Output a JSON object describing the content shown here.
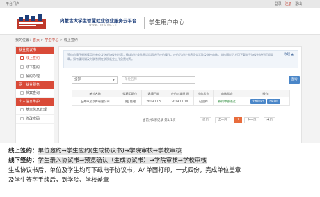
{
  "topbar": {
    "home_label": "平台门户",
    "login_link": "登录",
    "register_link": "注册",
    "extra": "退出"
  },
  "header": {
    "site_title": "内蒙古大学生智慧就业创业服务云平台",
    "site_url": "www.nmbys.cn",
    "center_title": "学生用户中心"
  },
  "breadcrumb": {
    "prefix": "我的位置：",
    "home": "首页",
    "section": "学生中心",
    "current": "线上签约"
  },
  "sidebar": {
    "groups": [
      {
        "title": "就业协议书",
        "items": [
          "线上签约",
          "线下签约",
          "解约办理"
        ]
      },
      {
        "title": "网上就业服务",
        "items": [
          "档案查询"
        ]
      },
      {
        "title": "个人信息维护",
        "items": [
          "基本信息管理",
          "修改密码"
        ]
      }
    ],
    "active_item": "线上签约"
  },
  "notice": {
    "text": "签约前请仔细阅读用人单位发送的协议书内容，确认协议条款无误后再进行应约操作。应约后协议书将提交学院及学校审核，审核通过后方可下载电子协议书进行打印盖章。如有疑问请及时联系所在学院就业工作负责老师。",
    "more_label": "收起 ▲"
  },
  "filter": {
    "type_value": "全部",
    "unit_placeholder": "单位名称",
    "query_label": "查询"
  },
  "table": {
    "headers": [
      "单位名称",
      "拟聘用职位",
      "邀请日期",
      "应约过期日期",
      "应约状态",
      "审核状态",
      "操作"
    ],
    "rows": [
      {
        "unit": "上海市某软件有限公司",
        "position": "项目管理",
        "invite_date": "2019.11.5",
        "expire_date": "2019.11.10",
        "status": "已应约",
        "audit": "新约审核通过",
        "ops": [
          "查看协议书",
          "下载协议"
        ]
      }
    ]
  },
  "pager": {
    "info": "当前共1条记录  第1/1页",
    "first": "首页",
    "prev": "上一页",
    "current": "1",
    "next": "下一页",
    "last": "末页"
  },
  "desc": {
    "online_label": "线上签约：",
    "online_flow": "单位邀约→学生应约(生成协议书)→学院审核→学校审核",
    "offline_label": "线下签约：",
    "offline_flow": "学生录入协议书→预览确认（生成协议书）→学院审核→学校审核",
    "para1": "生成协议书后，单位及学生均可下载电子协议书，A4单面打印，一式四份，完成单位盖章",
    "para2": "及学生签字手续后，到学院、学校盖章"
  }
}
